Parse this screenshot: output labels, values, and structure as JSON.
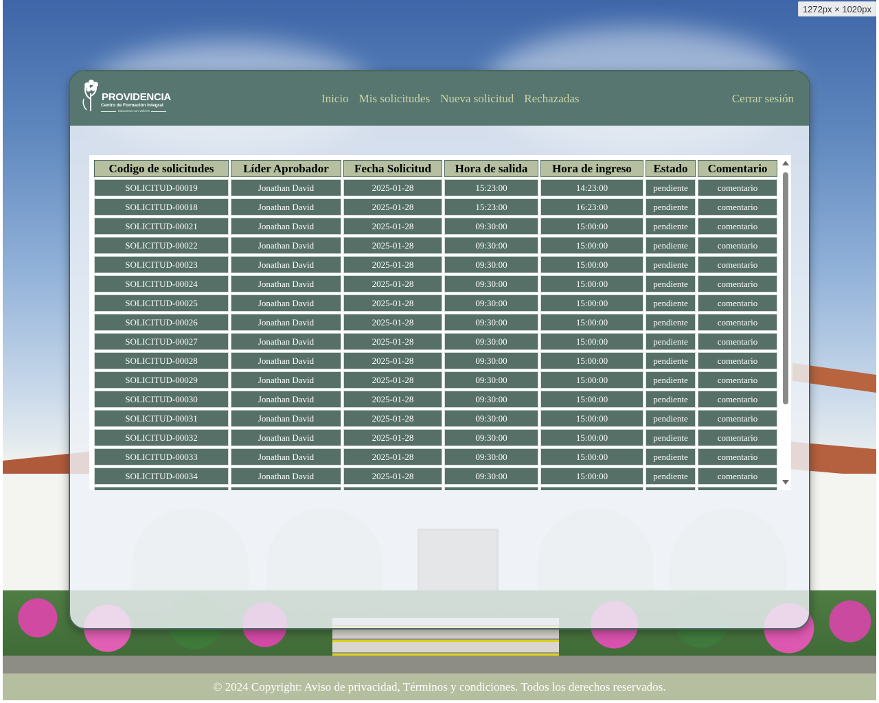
{
  "brand": {
    "name": "PROVIDENCIA",
    "subtitle": "Centro de Formación Integral",
    "tagline": "Educamos con Valores"
  },
  "nav": {
    "links": [
      "Inicio",
      "Mis solicitudes",
      "Nueva solicitud",
      "Rechazadas"
    ],
    "logout": "Cerrar sesión"
  },
  "table": {
    "headers": [
      "Codigo de solicitudes",
      "Líder Aprobador",
      "Fecha Solicitud",
      "Hora de salida",
      "Hora de ingreso",
      "Estado",
      "Comentario"
    ],
    "rows": [
      [
        "SOLICITUD-00019",
        "Jonathan David",
        "2025-01-28",
        "15:23:00",
        "14:23:00",
        "pendiente",
        "comentario"
      ],
      [
        "SOLICITUD-00018",
        "Jonathan David",
        "2025-01-28",
        "15:23:00",
        "16:23:00",
        "pendiente",
        "comentario"
      ],
      [
        "SOLICITUD-00021",
        "Jonathan David",
        "2025-01-28",
        "09:30:00",
        "15:00:00",
        "pendiente",
        "comentario"
      ],
      [
        "SOLICITUD-00022",
        "Jonathan David",
        "2025-01-28",
        "09:30:00",
        "15:00:00",
        "pendiente",
        "comentario"
      ],
      [
        "SOLICITUD-00023",
        "Jonathan David",
        "2025-01-28",
        "09:30:00",
        "15:00:00",
        "pendiente",
        "comentario"
      ],
      [
        "SOLICITUD-00024",
        "Jonathan David",
        "2025-01-28",
        "09:30:00",
        "15:00:00",
        "pendiente",
        "comentario"
      ],
      [
        "SOLICITUD-00025",
        "Jonathan David",
        "2025-01-28",
        "09:30:00",
        "15:00:00",
        "pendiente",
        "comentario"
      ],
      [
        "SOLICITUD-00026",
        "Jonathan David",
        "2025-01-28",
        "09:30:00",
        "15:00:00",
        "pendiente",
        "comentario"
      ],
      [
        "SOLICITUD-00027",
        "Jonathan David",
        "2025-01-28",
        "09:30:00",
        "15:00:00",
        "pendiente",
        "comentario"
      ],
      [
        "SOLICITUD-00028",
        "Jonathan David",
        "2025-01-28",
        "09:30:00",
        "15:00:00",
        "pendiente",
        "comentario"
      ],
      [
        "SOLICITUD-00029",
        "Jonathan David",
        "2025-01-28",
        "09:30:00",
        "15:00:00",
        "pendiente",
        "comentario"
      ],
      [
        "SOLICITUD-00030",
        "Jonathan David",
        "2025-01-28",
        "09:30:00",
        "15:00:00",
        "pendiente",
        "comentario"
      ],
      [
        "SOLICITUD-00031",
        "Jonathan David",
        "2025-01-28",
        "09:30:00",
        "15:00:00",
        "pendiente",
        "comentario"
      ],
      [
        "SOLICITUD-00032",
        "Jonathan David",
        "2025-01-28",
        "09:30:00",
        "15:00:00",
        "pendiente",
        "comentario"
      ],
      [
        "SOLICITUD-00033",
        "Jonathan David",
        "2025-01-28",
        "09:30:00",
        "15:00:00",
        "pendiente",
        "comentario"
      ],
      [
        "SOLICITUD-00034",
        "Jonathan David",
        "2025-01-28",
        "09:30:00",
        "15:00:00",
        "pendiente",
        "comentario"
      ]
    ]
  },
  "footer": {
    "text": "© 2024 Copyright: Aviso de privacidad, Términos y condiciones. Todos los derechos reservados."
  },
  "viewport_badge": "1272px × 1020px",
  "colors": {
    "navbar": "#587670",
    "nav_link": "#c8d4a4",
    "table_header": "#b6c0a0",
    "table_cell": "#567068",
    "footer": "#b5bf9f"
  }
}
